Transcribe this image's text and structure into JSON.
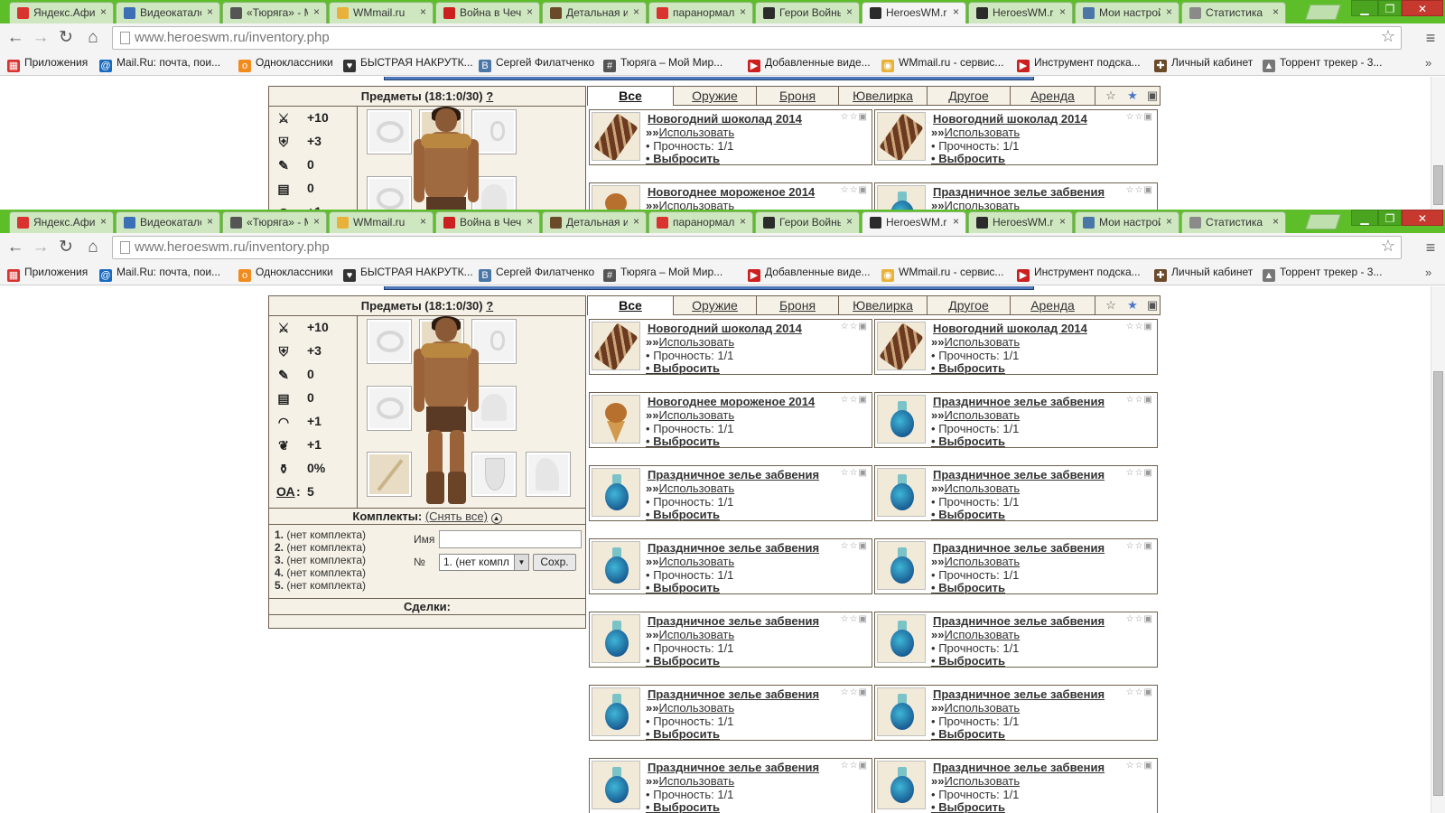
{
  "browser": {
    "tabs": [
      {
        "label": "Яндекс.Афиша",
        "fav": "#d9332f"
      },
      {
        "label": "Видеокаталог",
        "fav": "#3d6fb6"
      },
      {
        "label": "«Тюряга» - Мой",
        "fav": "#555555"
      },
      {
        "label": "WMmail.ru",
        "fav": "#e8b23a"
      },
      {
        "label": "Война в Чечне",
        "fav": "#cc1f1f"
      },
      {
        "label": "Детальная информ",
        "fav": "#6b4a2a"
      },
      {
        "label": "паранормальное",
        "fav": "#d9332f"
      },
      {
        "label": "Герои Войны",
        "fav": "#2b2b2b"
      },
      {
        "label": "HeroesWM.ru",
        "fav": "#2b2b2b"
      },
      {
        "label": "HeroesWM.ru",
        "fav": "#2b2b2b"
      },
      {
        "label": "Мои настройки",
        "fav": "#4a76a8"
      },
      {
        "label": "Статистика",
        "fav": "#8a8a8a"
      }
    ],
    "active_tab": 8,
    "close_glyph": "×",
    "url_host": "www.heroeswm.ru",
    "url_path": "/inventory.php",
    "bookmarks": [
      {
        "label": "Приложения",
        "icon": "apps-icon",
        "color": "#d9332f",
        "glyph": "▦"
      },
      {
        "label": "Mail.Ru: почта, пои...",
        "icon": "mailru-icon",
        "color": "#1a6bbf",
        "glyph": "@"
      },
      {
        "label": "Одноклассники",
        "icon": "ok-icon",
        "color": "#f28b1e",
        "glyph": "о"
      },
      {
        "label": "БЫСТРАЯ НАКРУТК...",
        "icon": "heart-icon",
        "color": "#333333",
        "glyph": "♥"
      },
      {
        "label": "Сергей Филатченко",
        "icon": "vk-icon",
        "color": "#4a76a8",
        "glyph": "В"
      },
      {
        "label": "Тюряга – Мой Мир...",
        "icon": "hash-icon",
        "color": "#555555",
        "glyph": "#"
      },
      {
        "label": "Добавленные виде...",
        "icon": "youtube-icon",
        "color": "#cc1f1f",
        "glyph": "▶"
      },
      {
        "label": "WMmail.ru - сервис...",
        "icon": "coin-icon",
        "color": "#e8b23a",
        "glyph": "◉"
      },
      {
        "label": "Инструмент подска...",
        "icon": "youtube-icon",
        "color": "#cc1f1f",
        "glyph": "▶"
      },
      {
        "label": "Личный кабинет",
        "icon": "gift-icon",
        "color": "#6b4a2a",
        "glyph": "✚"
      },
      {
        "label": "Торрент трекер - 3...",
        "icon": "torrent-icon",
        "color": "#777777",
        "glyph": "▲"
      }
    ]
  },
  "page": {
    "items_header": "Предметы (18:1:0/30)",
    "help_mark": "?",
    "stats": [
      {
        "icon": "sword-icon",
        "glyph": "⚔",
        "value": "+10"
      },
      {
        "icon": "shield-icon",
        "glyph": "⛨",
        "value": "+3"
      },
      {
        "icon": "wand-icon",
        "glyph": "✎",
        "value": "0"
      },
      {
        "icon": "scroll-icon",
        "glyph": "▤",
        "value": "0"
      },
      {
        "icon": "rainbow-icon",
        "glyph": "◠",
        "value": "+1"
      },
      {
        "icon": "wings-icon",
        "glyph": "❦",
        "value": "+1"
      },
      {
        "icon": "potion-icon",
        "glyph": "⚱",
        "value": "0%"
      }
    ],
    "oa_label": "ОА",
    "oa_value": "5",
    "kits_label": "Комплекты:",
    "kits_remove": "(Снять все)",
    "kits": [
      {
        "num": "1.",
        "label": "(нет комплекта)"
      },
      {
        "num": "2.",
        "label": "(нет комплекта)"
      },
      {
        "num": "3.",
        "label": "(нет комплекта)"
      },
      {
        "num": "4.",
        "label": "(нет комплекта)"
      },
      {
        "num": "5.",
        "label": "(нет комплекта)"
      }
    ],
    "kit_name_label": "Имя",
    "kit_num_label": "№",
    "kit_select_value": "1. (нет компл",
    "kit_save": "Сохр.",
    "deals_label": "Сделки:",
    "categories": [
      "Все",
      "Оружие",
      "Броня",
      "Ювелирка",
      "Другое",
      "Аренда"
    ],
    "active_category": 0,
    "use_prefix": "»»",
    "use_label": "Использовать",
    "durability_prefix": "•",
    "durability_label": "Прочность: 1/1",
    "drop_label": "Выбросить",
    "items": [
      {
        "name": "Новогодний шоколад 2014",
        "kind": "chocolate"
      },
      {
        "name": "Новогодний шоколад 2014",
        "kind": "chocolate"
      },
      {
        "name": "Новогоднее мороженое 2014",
        "kind": "icecream"
      },
      {
        "name": "Праздничное зелье забвения",
        "kind": "potion"
      },
      {
        "name": "Праздничное зелье забвения",
        "kind": "potion"
      },
      {
        "name": "Праздничное зелье забвения",
        "kind": "potion"
      },
      {
        "name": "Праздничное зелье забвения",
        "kind": "potion"
      },
      {
        "name": "Праздничное зелье забвения",
        "kind": "potion"
      },
      {
        "name": "Праздничное зелье забвения",
        "kind": "potion"
      },
      {
        "name": "Праздничное зелье забвения",
        "kind": "potion"
      },
      {
        "name": "Праздничное зелье забвения",
        "kind": "potion"
      },
      {
        "name": "Праздничное зелье забвения",
        "kind": "potion"
      },
      {
        "name": "Праздничное зелье забвения",
        "kind": "potion"
      },
      {
        "name": "Праздничное зелье забвения",
        "kind": "potion"
      }
    ]
  }
}
